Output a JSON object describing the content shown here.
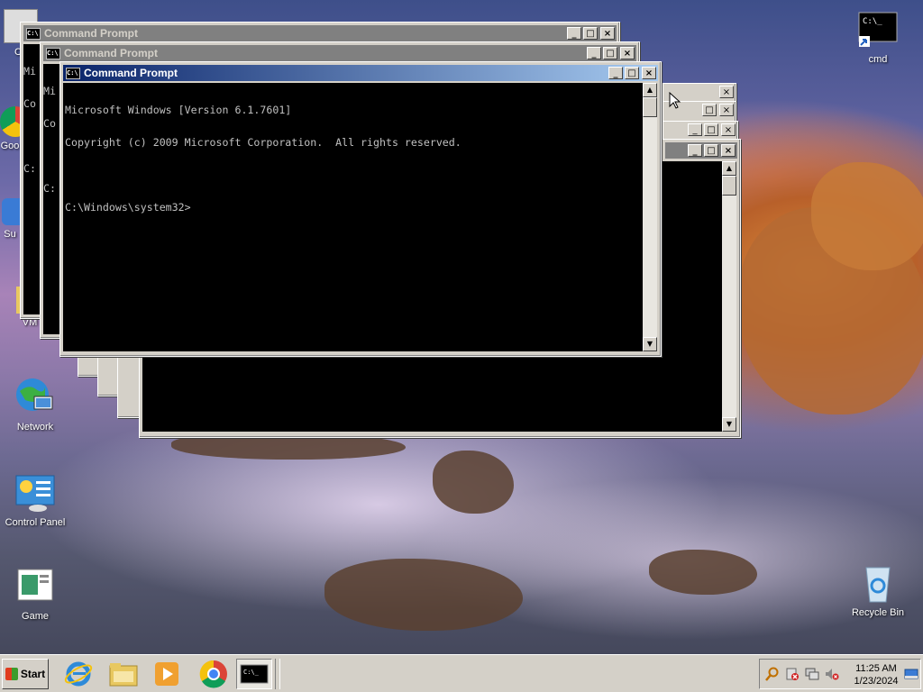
{
  "desktop": {
    "icons": [
      {
        "label": "Network",
        "icon": "network-globe-icon"
      },
      {
        "label": "Control Panel",
        "icon": "control-panel-icon"
      },
      {
        "label": "Game",
        "icon": "game-icon"
      },
      {
        "label": "cmd",
        "icon": "cmd-shortcut-icon"
      },
      {
        "label": "Recycle Bin",
        "icon": "recycle-bin-icon"
      }
    ],
    "partial_labels": [
      "C",
      "Co",
      "Goo",
      "Su",
      "VM"
    ]
  },
  "windows": {
    "title": "Command Prompt",
    "console_line1": "Microsoft Windows [Version 6.1.7601]",
    "console_line2": "Copyright (c) 2009 Microsoft Corporation.  All rights reserved.",
    "console_line3": "",
    "console_line4": "C:\\Windows\\system32>",
    "back_line1": "Mi",
    "back_line2": "Co",
    "back_line3": "C:",
    "minimize_glyph": "_",
    "maximize_glyph": "□",
    "close_glyph": "×"
  },
  "taskbar": {
    "start_label": "Start",
    "pinned": [
      "internet-explorer-icon",
      "file-explorer-icon",
      "media-player-icon",
      "chrome-icon",
      "command-prompt-icon"
    ],
    "tray_icons": [
      "search-icon",
      "network-error-icon",
      "display-icon",
      "volume-muted-icon",
      "show-desktop-icon"
    ],
    "time": "11:25 AM",
    "date": "1/23/2024"
  },
  "colors": {
    "taskbar": "#d4d0c8",
    "active_title": "#0a246a",
    "inactive_title": "#808080"
  }
}
